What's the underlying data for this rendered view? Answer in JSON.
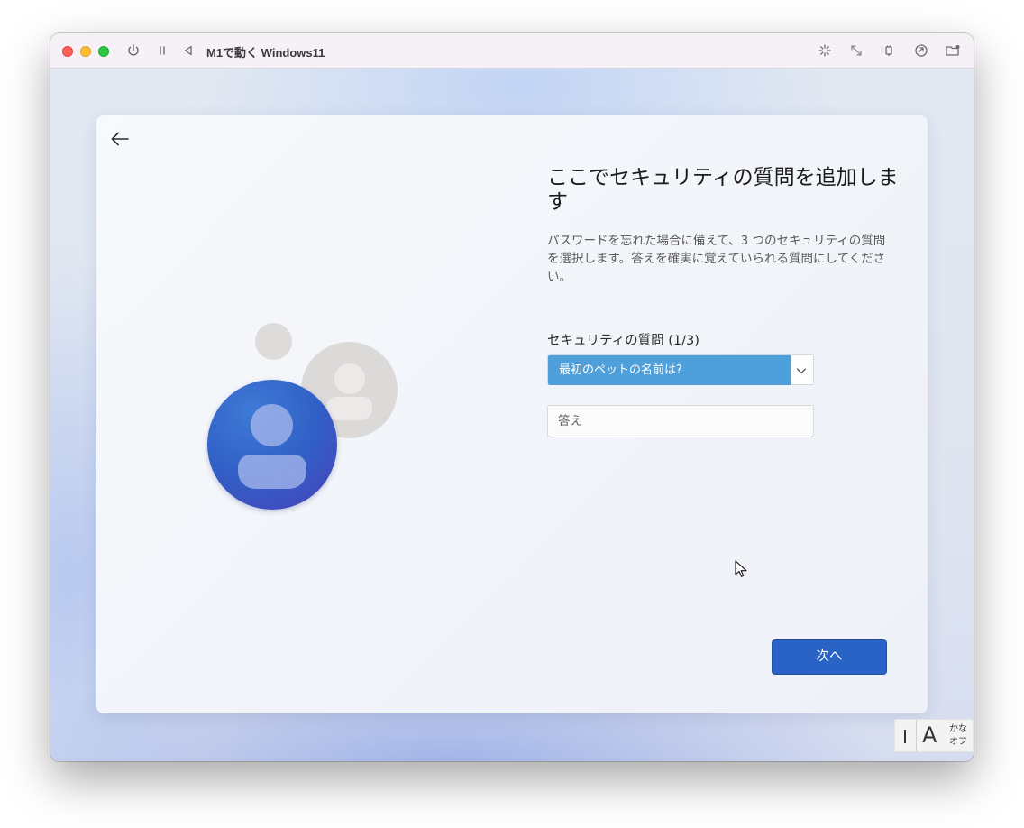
{
  "window": {
    "title": "M1で動く Windows11",
    "controls": {
      "close": "close-button",
      "minimize": "minimize-button",
      "zoom": "zoom-button"
    },
    "toolbar_left_icons": [
      "power-icon",
      "pause-icon",
      "play-back-icon"
    ],
    "toolbar_right_icons": [
      "sparkle-icon",
      "resize-icon",
      "usb-icon",
      "share-icon",
      "folder-icon"
    ]
  },
  "setup": {
    "heading": "ここでセキュリティの質問を追加します",
    "description": "パスワードを忘れた場合に備えて、3 つのセキュリティの質問を選択します。答えを確実に覚えていられる質問にしてください。",
    "question_label": "セキュリティの質問 (1/3)",
    "question_selected": "最初のペットの名前は?",
    "answer_placeholder": "答え",
    "next_label": "次へ"
  },
  "ime": {
    "mode_letter": "A",
    "kana_line1": "かな",
    "kana_line2": "オフ"
  },
  "colors": {
    "accent": "#2a63c6",
    "dropdown_selected": "#4f9fda",
    "avatar_blue": "#3160c7"
  }
}
